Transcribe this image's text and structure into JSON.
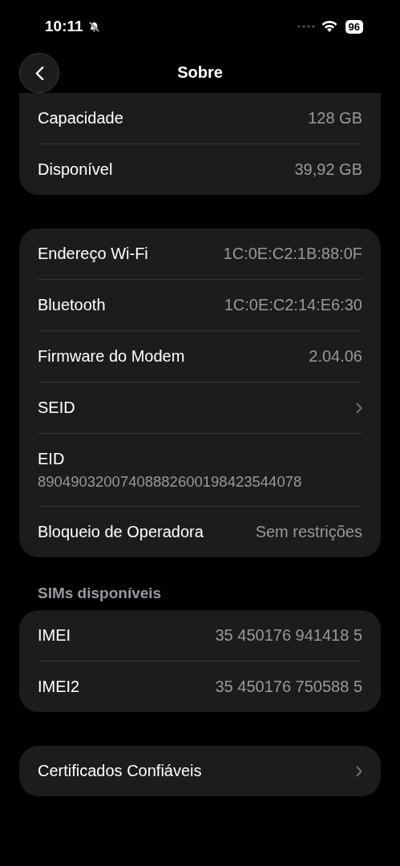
{
  "status_bar": {
    "time": "10:11",
    "silent": true,
    "battery": "96"
  },
  "nav": {
    "title": "Sobre"
  },
  "groups": [
    {
      "rows": [
        {
          "kind": "value",
          "label": "Capacidade",
          "value": "128 GB"
        },
        {
          "kind": "value",
          "label": "Disponível",
          "value": "39,92 GB"
        }
      ],
      "cut_top": true
    },
    {
      "rows": [
        {
          "kind": "value",
          "label": "Endereço Wi-Fi",
          "value": "1C:0E:C2:1B:88:0F"
        },
        {
          "kind": "value",
          "label": "Bluetooth",
          "value": "1C:0E:C2:14:E6:30"
        },
        {
          "kind": "value",
          "label": "Firmware do Modem",
          "value": "2.04.06"
        },
        {
          "kind": "chevron",
          "label": "SEID"
        },
        {
          "kind": "stacked",
          "label": "EID",
          "value": "89049032007408882600198423544078"
        },
        {
          "kind": "value",
          "label": "Bloqueio de Operadora",
          "value": "Sem restrições"
        }
      ]
    },
    {
      "header": "SIMs disponíveis",
      "rows": [
        {
          "kind": "value",
          "label": "IMEI",
          "value": "35 450176 941418 5"
        },
        {
          "kind": "value",
          "label": "IMEI2",
          "value": "35 450176 750588 5"
        }
      ]
    },
    {
      "rows": [
        {
          "kind": "chevron",
          "label": "Certificados Confiáveis"
        }
      ]
    }
  ]
}
